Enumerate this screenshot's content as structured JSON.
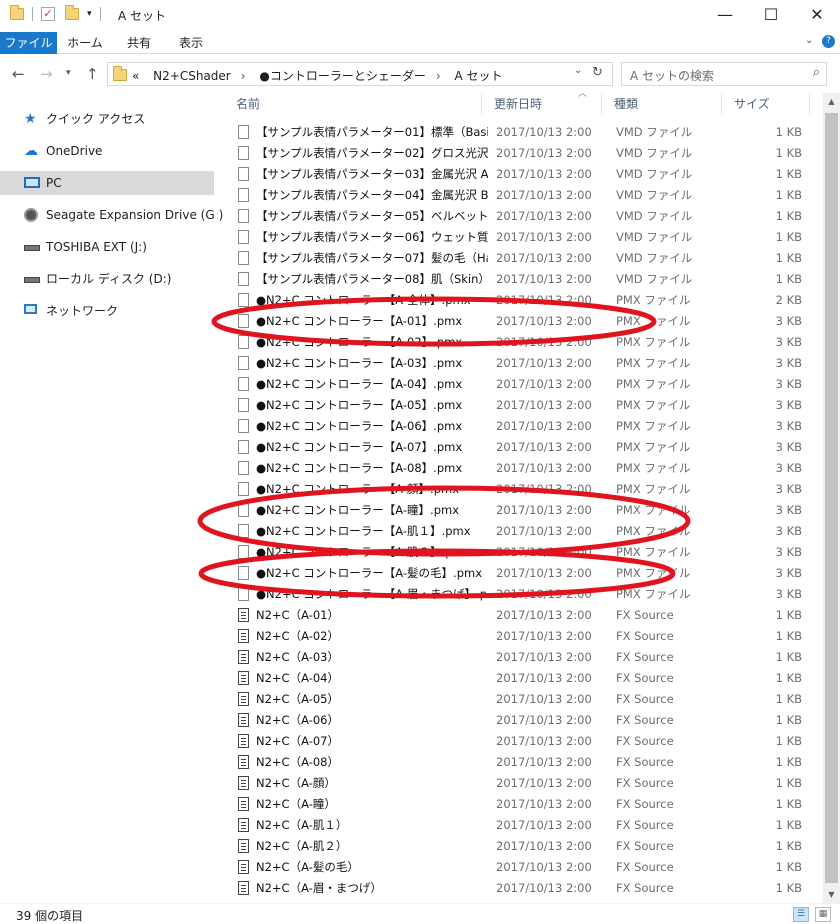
{
  "window": {
    "title": "A セット",
    "minimize_icon": "minimize-icon",
    "maximize_icon": "maximize-icon",
    "close_icon": "close-icon"
  },
  "ribbon": {
    "tabs": [
      "ファイル",
      "ホーム",
      "共有",
      "表示"
    ]
  },
  "address": {
    "overflow": "«",
    "crumbs": [
      "N2+CShader",
      "●コントローラーとシェーダー",
      "A セット"
    ],
    "search_placeholder": "A セットの検索"
  },
  "nav": {
    "items": [
      {
        "label": "クイック アクセス",
        "icon": "star-icon"
      },
      {
        "label": "OneDrive",
        "icon": "cloud-icon"
      },
      {
        "label": "PC",
        "icon": "pc-icon"
      },
      {
        "label": "Seagate Expansion Drive (G:)",
        "icon": "drive-icon"
      },
      {
        "label": "TOSHIBA EXT (J:)",
        "icon": "drive-icon"
      },
      {
        "label": "ローカル ディスク (D:)",
        "icon": "drive-icon"
      },
      {
        "label": "ネットワーク",
        "icon": "network-icon"
      }
    ]
  },
  "columns": {
    "name": "名前",
    "date": "更新日時",
    "type": "種類",
    "size": "サイズ"
  },
  "files": [
    {
      "name": "【サンプル表情パラメーター01】標準（Basic）....",
      "date": "2017/10/13 2:00",
      "type": "VMD ファイル",
      "size": "1 KB",
      "kind": "file"
    },
    {
      "name": "【サンプル表情パラメーター02】グロス光沢（Gl...",
      "date": "2017/10/13 2:00",
      "type": "VMD ファイル",
      "size": "1 KB",
      "kind": "file"
    },
    {
      "name": "【サンプル表情パラメーター03】金属光沢 A（...",
      "date": "2017/10/13 2:00",
      "type": "VMD ファイル",
      "size": "1 KB",
      "kind": "file"
    },
    {
      "name": "【サンプル表情パラメーター04】金属光沢 B（...",
      "date": "2017/10/13 2:00",
      "type": "VMD ファイル",
      "size": "1 KB",
      "kind": "file"
    },
    {
      "name": "【サンプル表情パラメーター05】ベルベット（Velv...",
      "date": "2017/10/13 2:00",
      "type": "VMD ファイル",
      "size": "1 KB",
      "kind": "file"
    },
    {
      "name": "【サンプル表情パラメーター06】ウェット質感（w...",
      "date": "2017/10/13 2:00",
      "type": "VMD ファイル",
      "size": "1 KB",
      "kind": "file"
    },
    {
      "name": "【サンプル表情パラメーター07】髪の毛（Hair）...",
      "date": "2017/10/13 2:00",
      "type": "VMD ファイル",
      "size": "1 KB",
      "kind": "file"
    },
    {
      "name": "【サンプル表情パラメーター08】肌（Skin）.vmd",
      "date": "2017/10/13 2:00",
      "type": "VMD ファイル",
      "size": "1 KB",
      "kind": "file"
    },
    {
      "name": "●N2+C コントローラー【A-全体】.pmx",
      "date": "2017/10/13 2:00",
      "type": "PMX ファイル",
      "size": "2 KB",
      "kind": "file"
    },
    {
      "name": "●N2+C コントローラー【A-01】.pmx",
      "date": "2017/10/13 2:00",
      "type": "PMX ファイル",
      "size": "3 KB",
      "kind": "file"
    },
    {
      "name": "●N2+C コントローラー【A-02】.pmx",
      "date": "2017/10/13 2:00",
      "type": "PMX ファイル",
      "size": "3 KB",
      "kind": "file"
    },
    {
      "name": "●N2+C コントローラー【A-03】.pmx",
      "date": "2017/10/13 2:00",
      "type": "PMX ファイル",
      "size": "3 KB",
      "kind": "file"
    },
    {
      "name": "●N2+C コントローラー【A-04】.pmx",
      "date": "2017/10/13 2:00",
      "type": "PMX ファイル",
      "size": "3 KB",
      "kind": "file"
    },
    {
      "name": "●N2+C コントローラー【A-05】.pmx",
      "date": "2017/10/13 2:00",
      "type": "PMX ファイル",
      "size": "3 KB",
      "kind": "file"
    },
    {
      "name": "●N2+C コントローラー【A-06】.pmx",
      "date": "2017/10/13 2:00",
      "type": "PMX ファイル",
      "size": "3 KB",
      "kind": "file"
    },
    {
      "name": "●N2+C コントローラー【A-07】.pmx",
      "date": "2017/10/13 2:00",
      "type": "PMX ファイル",
      "size": "3 KB",
      "kind": "file"
    },
    {
      "name": "●N2+C コントローラー【A-08】.pmx",
      "date": "2017/10/13 2:00",
      "type": "PMX ファイル",
      "size": "3 KB",
      "kind": "file"
    },
    {
      "name": "●N2+C コントローラー【A-顔】.pmx",
      "date": "2017/10/13 2:00",
      "type": "PMX ファイル",
      "size": "3 KB",
      "kind": "file"
    },
    {
      "name": "●N2+C コントローラー【A-瞳】.pmx",
      "date": "2017/10/13 2:00",
      "type": "PMX ファイル",
      "size": "3 KB",
      "kind": "file"
    },
    {
      "name": "●N2+C コントローラー【A-肌１】.pmx",
      "date": "2017/10/13 2:00",
      "type": "PMX ファイル",
      "size": "3 KB",
      "kind": "file"
    },
    {
      "name": "●N2+C コントローラー【A-肌２】.pmx",
      "date": "2017/10/13 2:00",
      "type": "PMX ファイル",
      "size": "3 KB",
      "kind": "file"
    },
    {
      "name": "●N2+C コントローラー【A-髪の毛】.pmx",
      "date": "2017/10/13 2:00",
      "type": "PMX ファイル",
      "size": "3 KB",
      "kind": "file"
    },
    {
      "name": "●N2+C コントローラー【A-眉・まつげ】.pmx",
      "date": "2017/10/13 2:00",
      "type": "PMX ファイル",
      "size": "3 KB",
      "kind": "file"
    },
    {
      "name": "N2+C（A-01）",
      "date": "2017/10/13 2:00",
      "type": "FX Source",
      "size": "1 KB",
      "kind": "src"
    },
    {
      "name": "N2+C（A-02）",
      "date": "2017/10/13 2:00",
      "type": "FX Source",
      "size": "1 KB",
      "kind": "src"
    },
    {
      "name": "N2+C（A-03）",
      "date": "2017/10/13 2:00",
      "type": "FX Source",
      "size": "1 KB",
      "kind": "src"
    },
    {
      "name": "N2+C（A-04）",
      "date": "2017/10/13 2:00",
      "type": "FX Source",
      "size": "1 KB",
      "kind": "src"
    },
    {
      "name": "N2+C（A-05）",
      "date": "2017/10/13 2:00",
      "type": "FX Source",
      "size": "1 KB",
      "kind": "src"
    },
    {
      "name": "N2+C（A-06）",
      "date": "2017/10/13 2:00",
      "type": "FX Source",
      "size": "1 KB",
      "kind": "src"
    },
    {
      "name": "N2+C（A-07）",
      "date": "2017/10/13 2:00",
      "type": "FX Source",
      "size": "1 KB",
      "kind": "src"
    },
    {
      "name": "N2+C（A-08）",
      "date": "2017/10/13 2:00",
      "type": "FX Source",
      "size": "1 KB",
      "kind": "src"
    },
    {
      "name": "N2+C（A-顔）",
      "date": "2017/10/13 2:00",
      "type": "FX Source",
      "size": "1 KB",
      "kind": "src"
    },
    {
      "name": "N2+C（A-瞳）",
      "date": "2017/10/13 2:00",
      "type": "FX Source",
      "size": "1 KB",
      "kind": "src"
    },
    {
      "name": "N2+C（A-肌１）",
      "date": "2017/10/13 2:00",
      "type": "FX Source",
      "size": "1 KB",
      "kind": "src"
    },
    {
      "name": "N2+C（A-肌２）",
      "date": "2017/10/13 2:00",
      "type": "FX Source",
      "size": "1 KB",
      "kind": "src"
    },
    {
      "name": "N2+C（A-髪の毛）",
      "date": "2017/10/13 2:00",
      "type": "FX Source",
      "size": "1 KB",
      "kind": "src"
    },
    {
      "name": "N2+C（A-眉・まつげ）",
      "date": "2017/10/13 2:00",
      "type": "FX Source",
      "size": "1 KB",
      "kind": "src"
    }
  ],
  "status": {
    "count": "39 個の項目"
  },
  "annotation": {
    "color": "#e0141e",
    "circled_rows": [
      "●N2+C コントローラー【A-01】.pmx",
      "●N2+C コントローラー【A-瞳】.pmx",
      "●N2+C コントローラー【A-肌１】.pmx",
      "●N2+C コントローラー【A-髪の毛】.pmx"
    ]
  }
}
